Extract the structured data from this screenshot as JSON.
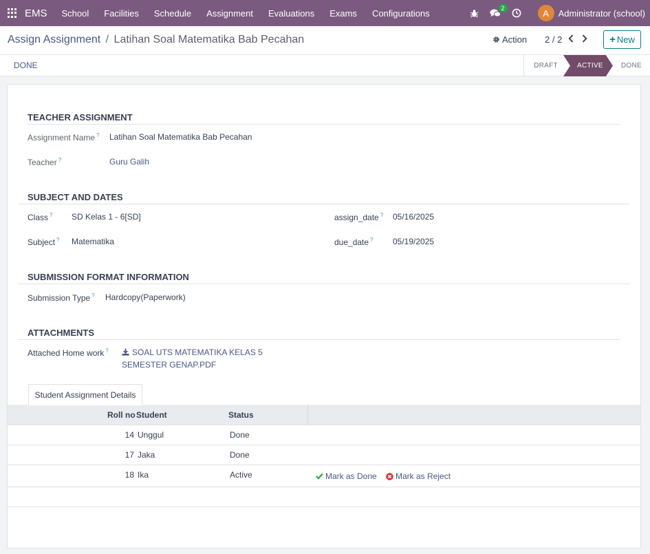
{
  "navbar": {
    "brand": "EMS",
    "menu": [
      "School",
      "Facilities",
      "Schedule",
      "Assignment",
      "Evaluations",
      "Exams",
      "Configurations"
    ],
    "chat_count": "2",
    "avatar_initial": "A",
    "user_name": "Administrator (school)"
  },
  "control_panel": {
    "breadcrumb_parent": "Assign Assignment",
    "breadcrumb_sep": "/",
    "breadcrumb_current": "Latihan Soal Matematika Bab Pecahan",
    "action_label": "Action",
    "pager": "2 / 2",
    "new_label": "New"
  },
  "statusbar": {
    "button": "DONE",
    "stages": [
      "DRAFT",
      "ACTIVE",
      "DONE"
    ],
    "active_stage": "ACTIVE"
  },
  "form": {
    "teacher_section": "TEACHER ASSIGNMENT",
    "assignment_name_label": "Assignment Name",
    "assignment_name": "Latihan Soal Matematika Bab Pecahan",
    "teacher_label": "Teacher",
    "teacher": "Guru Galih",
    "subject_section": "SUBJECT AND DATES",
    "class_label": "Class",
    "class": "SD Kelas 1 - 6[SD]",
    "subject_label": "Subject",
    "subject": "Matematika",
    "assign_date_label": "assign_date",
    "assign_date": "05/16/2025",
    "due_date_label": "due_date",
    "due_date": "05/19/2025",
    "submission_section": "SUBMISSION FORMAT INFORMATION",
    "submission_type_label": "Submission Type",
    "submission_type": "Hardcopy(Paperwork)",
    "attachments_section": "ATTACHMENTS",
    "attached_label": "Attached Home work",
    "attached_file": "SOAL UTS MATEMATIKA KELAS 5 SEMESTER GENAP.PDF",
    "help_mark": "?"
  },
  "tab": {
    "label": "Student Assignment Details"
  },
  "table": {
    "headers": {
      "roll": "Roll no",
      "student": "Student",
      "status": "Status"
    },
    "rows": [
      {
        "roll": "14",
        "student": "Unggul",
        "status": "Done"
      },
      {
        "roll": "17",
        "student": "Jaka",
        "status": "Done"
      },
      {
        "roll": "18",
        "student": "Ika",
        "status": "Active"
      }
    ],
    "mark_done": "Mark as Done",
    "mark_reject": "Mark as Reject"
  },
  "colors": {
    "navbar": "#7a5a7e",
    "active_stage": "#714b67",
    "new_button": "#017e84",
    "done_check": "#28a745",
    "reject": "#dc3545"
  }
}
